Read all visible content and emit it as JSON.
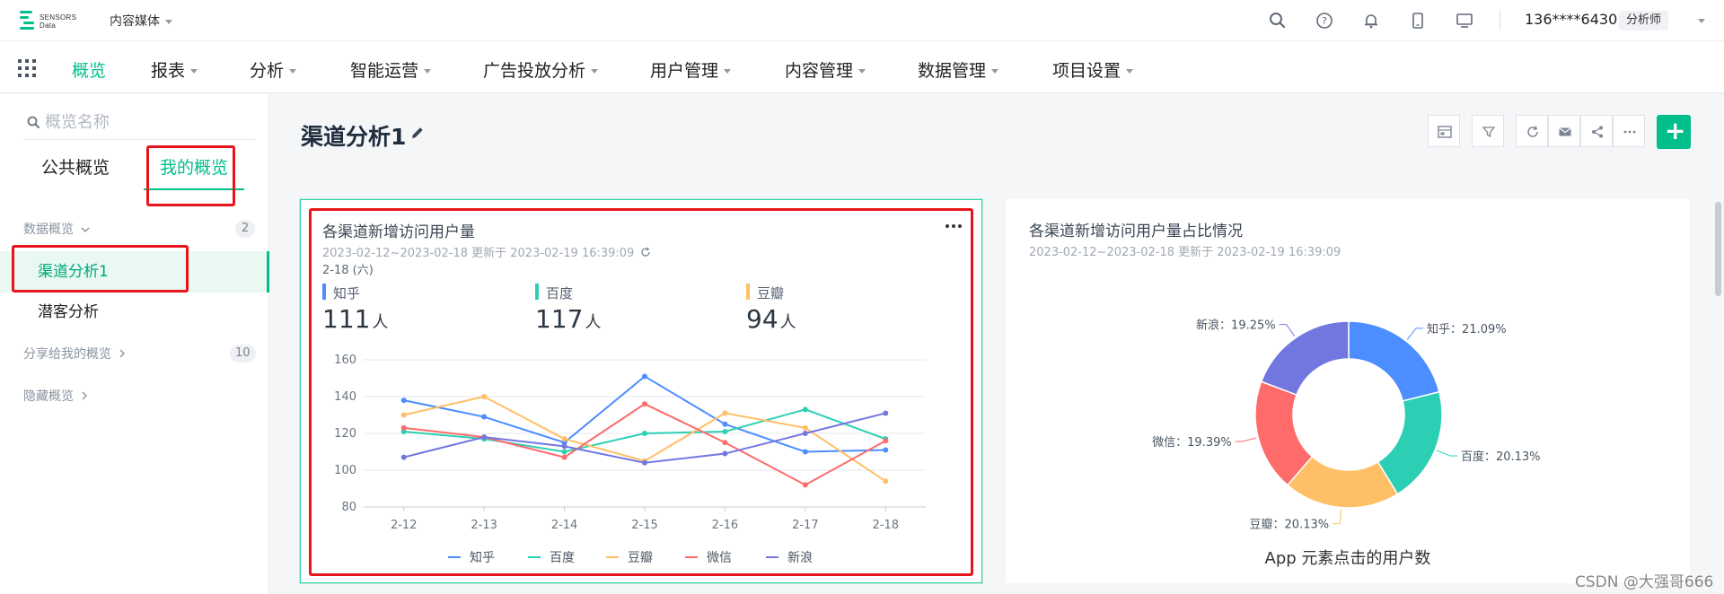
{
  "brand": {
    "logo_text_1": "SENSORS",
    "logo_text_2": "Data",
    "accent": "#00bf8a"
  },
  "project": {
    "name": "内容媒体"
  },
  "user": {
    "phone": "136****6430",
    "role": "分析师"
  },
  "top_icons": [
    "search-icon",
    "help-icon",
    "bell-icon",
    "mobile-icon",
    "monitor-icon"
  ],
  "nav": {
    "items": [
      {
        "label": "概览",
        "active": true,
        "dropdown": false
      },
      {
        "label": "报表",
        "dropdown": true
      },
      {
        "label": "分析",
        "dropdown": true
      },
      {
        "label": "智能运营",
        "dropdown": true
      },
      {
        "label": "广告投放分析",
        "dropdown": true
      },
      {
        "label": "用户管理",
        "dropdown": true
      },
      {
        "label": "内容管理",
        "dropdown": true
      },
      {
        "label": "数据管理",
        "dropdown": true
      },
      {
        "label": "项目设置",
        "dropdown": true
      }
    ]
  },
  "sidebar": {
    "search_placeholder": "概览名称",
    "tabs": [
      {
        "label": "公共概览"
      },
      {
        "label": "我的概览",
        "active": true
      }
    ],
    "groups": [
      {
        "label": "数据概览",
        "count": "2",
        "items": [
          {
            "label": "渠道分析1",
            "active": true
          },
          {
            "label": "潜客分析"
          }
        ]
      },
      {
        "label": "分享给我的概览",
        "count": "10"
      },
      {
        "label": "隐藏概览"
      }
    ]
  },
  "page": {
    "title": "渠道分析1"
  },
  "cards": {
    "left": {
      "title": "各渠道新增访问用户量",
      "subtitle": "2023-02-12~2023-02-18 更新于 2023-02-19 16:39:09",
      "date_label": "2-18 (六)",
      "metrics": [
        {
          "name": "知乎",
          "value": "111",
          "unit": "人",
          "color": "#4c8dff"
        },
        {
          "name": "百度",
          "value": "117",
          "unit": "人",
          "color": "#2dcfb4"
        },
        {
          "name": "豆瓣",
          "value": "94",
          "unit": "人",
          "color": "#ffbf66"
        }
      ]
    },
    "right": {
      "title": "各渠道新增访问用户量占比情况",
      "subtitle": "2023-02-12~2023-02-18 更新于 2023-02-19 16:39:09",
      "footer": "App 元素点击的用户数"
    }
  },
  "chart_data": [
    {
      "type": "line",
      "categories": [
        "2-12",
        "2-13",
        "2-14",
        "2-15",
        "2-16",
        "2-17",
        "2-18"
      ],
      "ylim": [
        80,
        160
      ],
      "yticks": [
        "80",
        "100",
        "120",
        "140",
        "160"
      ],
      "grid": true,
      "legend_position": "bottom",
      "series": [
        {
          "name": "知乎",
          "color": "#4c8dff",
          "values": [
            138,
            129,
            115,
            151,
            125,
            110,
            111
          ]
        },
        {
          "name": "百度",
          "color": "#2dcfb4",
          "values": [
            121,
            117,
            110,
            120,
            121,
            133,
            117
          ]
        },
        {
          "name": "豆瓣",
          "color": "#ffbf66",
          "values": [
            130,
            140,
            117,
            105,
            131,
            123,
            94
          ]
        },
        {
          "name": "微信",
          "color": "#ff6b6b",
          "values": [
            123,
            118,
            107,
            136,
            115,
            92,
            116
          ]
        },
        {
          "name": "新浪",
          "color": "#7277e0",
          "values": [
            107,
            118,
            113,
            104,
            109,
            120,
            131
          ]
        }
      ]
    },
    {
      "type": "pie",
      "donut": true,
      "slices": [
        {
          "name": "知乎",
          "value": 21.09,
          "label": "知乎：21.09%",
          "color": "#4c8dff"
        },
        {
          "name": "百度",
          "value": 20.13,
          "label": "百度：20.13%",
          "color": "#2dcfb4"
        },
        {
          "name": "豆瓣",
          "value": 20.13,
          "label": "豆瓣：20.13%",
          "color": "#ffbf66"
        },
        {
          "name": "微信",
          "value": 19.39,
          "label": "微信：19.39%",
          "color": "#ff6b6b"
        },
        {
          "name": "新浪",
          "value": 19.25,
          "label": "新浪：19.25%",
          "color": "#7277e0"
        }
      ]
    }
  ],
  "watermark": "CSDN @大强哥666"
}
